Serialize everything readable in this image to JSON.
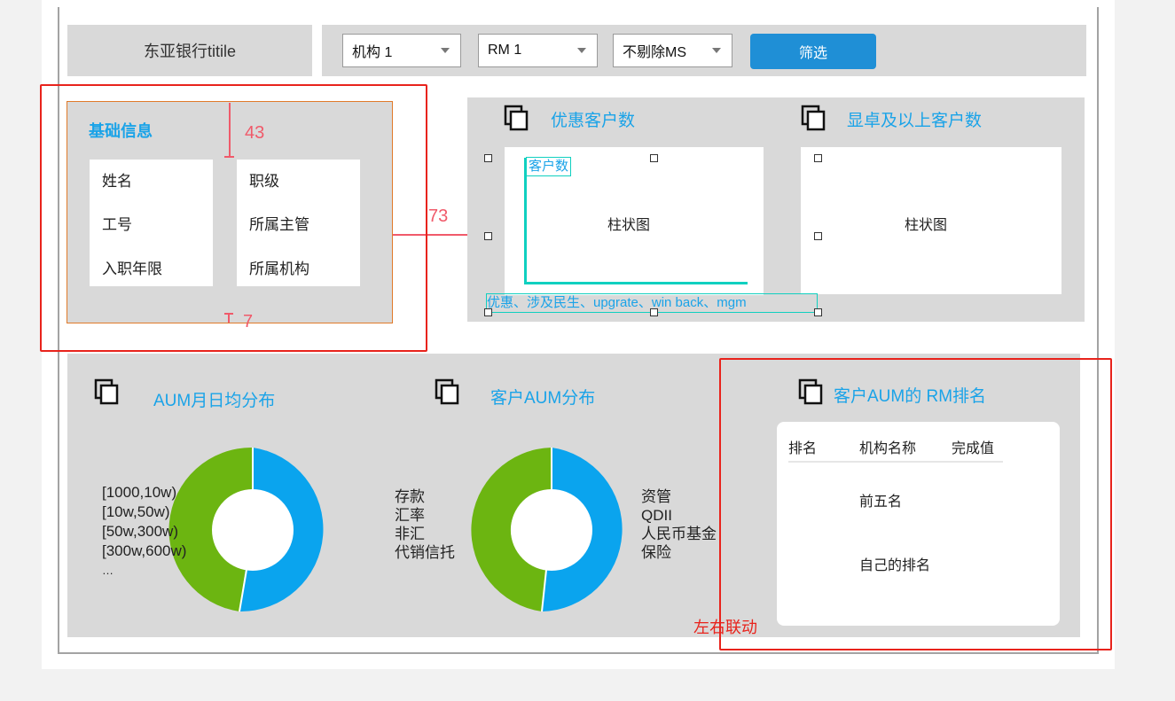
{
  "header": {
    "title": "东亚银行titile",
    "filters": {
      "institution": "机构 1",
      "rm": "RM 1",
      "ms": "不剔除MS",
      "filter_button": "筛选"
    }
  },
  "basic_info": {
    "title": "基础信息",
    "left_fields": [
      "姓名",
      "工号",
      "入职年限"
    ],
    "right_fields": [
      "职级",
      "所属主管",
      "所属机构"
    ]
  },
  "annotations": {
    "top_gap": "43",
    "side_gap": "73",
    "bottom_gap": "7",
    "linkage": "左右联动"
  },
  "charts": {
    "preferred": {
      "title": "优惠客户数",
      "y_label": "客户数",
      "placeholder": "柱状图",
      "x_caption": "优惠、涉及民生、upgrate、win back、mgm"
    },
    "premier": {
      "title": "显卓及以上客户数",
      "placeholder": "柱状图"
    }
  },
  "aum_monthly": {
    "title": "AUM月日均分布",
    "legend": [
      "[1000,10w)",
      "[10w,50w)",
      "[50w,300w)",
      "[300w,600w)",
      "…"
    ]
  },
  "customer_aum": {
    "title": "客户AUM分布",
    "left_labels": [
      "存款",
      "汇率",
      "非汇",
      "代销信托"
    ],
    "right_labels": [
      "资管",
      "QDII",
      "人民币基金",
      "保险"
    ]
  },
  "ranking": {
    "title": "客户AUM的 RM排名",
    "columns": [
      "排名",
      "机构名称",
      "完成值"
    ],
    "rows": [
      "前五名",
      "自己的排名"
    ]
  },
  "colors": {
    "accent_blue": "#1aa3e8",
    "donut_blue": "#0aa4ee",
    "donut_green": "#6cb511",
    "annotation_red": "#e8231c",
    "teal": "#10d0c0"
  }
}
